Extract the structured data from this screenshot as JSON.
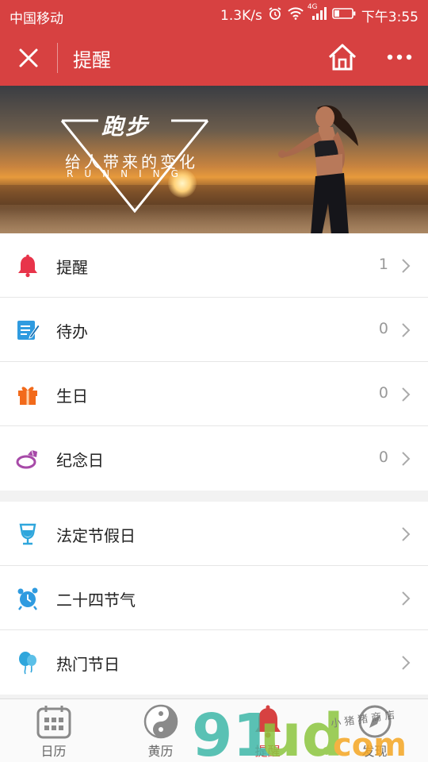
{
  "status_bar": {
    "carrier": "中国移动",
    "speed": "1.3K/s",
    "network": "4G",
    "time": "下午3:55"
  },
  "nav": {
    "title": "提醒",
    "close_icon": "close-icon",
    "home_icon": "home-icon",
    "more_icon": "more-icon"
  },
  "banner": {
    "headline": "跑步",
    "subtitle": "给人带来的变化",
    "english": "RUNNING"
  },
  "reminder_group": [
    {
      "label": "提醒",
      "count": "1",
      "icon": "bell-icon",
      "color": "#e8344a"
    },
    {
      "label": "待办",
      "count": "0",
      "icon": "todo-icon",
      "color": "#2f9be0"
    },
    {
      "label": "生日",
      "count": "0",
      "icon": "gift-icon",
      "color": "#f26a1b"
    },
    {
      "label": "纪念日",
      "count": "0",
      "icon": "ring-icon",
      "color": "#a74aa8"
    }
  ],
  "festival_group": [
    {
      "label": "法定节假日",
      "icon": "wine-glass-icon",
      "color": "#2fa6dc"
    },
    {
      "label": "二十四节气",
      "icon": "alarm-clock-icon",
      "color": "#2f9be0"
    },
    {
      "label": "热门节日",
      "icon": "balloon-icon",
      "color": "#2fa6dc"
    }
  ],
  "tabs": [
    {
      "label": "日历",
      "icon": "calendar-icon",
      "active": false
    },
    {
      "label": "黄历",
      "icon": "yinyang-icon",
      "active": false
    },
    {
      "label": "提醒",
      "icon": "bell-icon",
      "active": true
    },
    {
      "label": "发现",
      "icon": "compass-icon",
      "active": false
    }
  ],
  "watermark": {
    "logo": "91ud.com",
    "tagline": "小猪猪商店"
  },
  "colors": {
    "brand_red": "#d74141",
    "count_gray": "#999999",
    "tab_active": "#d74141"
  }
}
